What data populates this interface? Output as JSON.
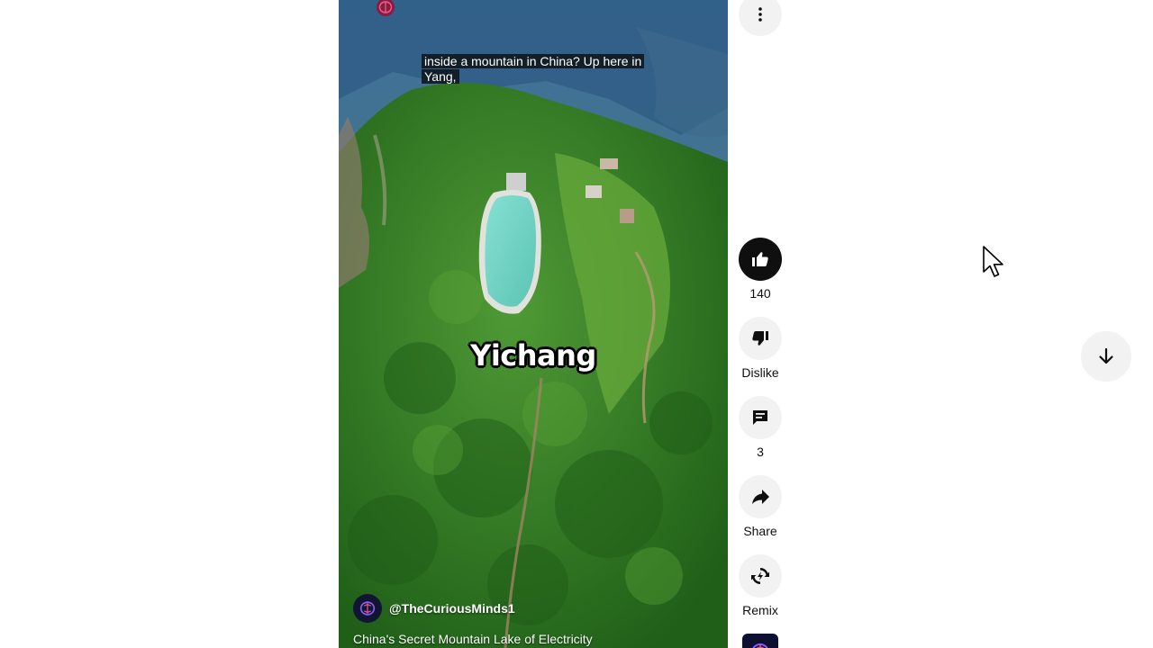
{
  "video": {
    "caption": "inside a mountain in China? Up here in Yang,",
    "overlay_word": "Yichang",
    "channel_handle": "@TheCuriousMinds1",
    "title": "China's Secret Mountain Lake of Electricity"
  },
  "actions": {
    "more_icon": "more-vertical-icon",
    "like": {
      "icon": "thumbs-up-icon",
      "label": "140",
      "active": true
    },
    "dislike": {
      "icon": "thumbs-down-icon",
      "label": "Dislike"
    },
    "comments": {
      "icon": "comment-icon",
      "label": "3"
    },
    "share": {
      "icon": "share-arrow-icon",
      "label": "Share"
    },
    "remix": {
      "icon": "remix-icon",
      "label": "Remix"
    }
  },
  "navigation": {
    "next_icon": "arrow-down-icon"
  },
  "colors": {
    "button_bg": "#f2f2f2",
    "active_button_bg": "#0f0f0f",
    "text": "#0f0f0f",
    "water": "#74d6c8",
    "forest": "#2f7a22"
  }
}
